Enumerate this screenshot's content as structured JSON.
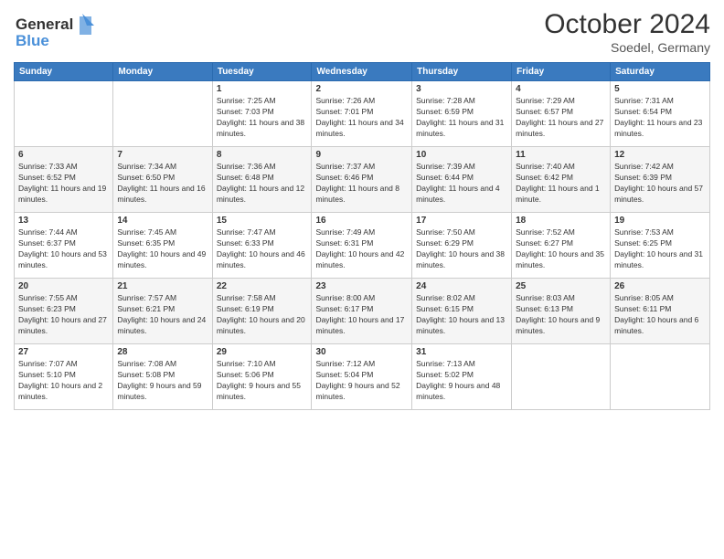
{
  "header": {
    "logo_line1": "General",
    "logo_line2": "Blue",
    "month": "October 2024",
    "location": "Soedel, Germany"
  },
  "days_of_week": [
    "Sunday",
    "Monday",
    "Tuesday",
    "Wednesday",
    "Thursday",
    "Friday",
    "Saturday"
  ],
  "weeks": [
    [
      {
        "day": "",
        "info": ""
      },
      {
        "day": "",
        "info": ""
      },
      {
        "day": "1",
        "info": "Sunrise: 7:25 AM\nSunset: 7:03 PM\nDaylight: 11 hours and 38 minutes."
      },
      {
        "day": "2",
        "info": "Sunrise: 7:26 AM\nSunset: 7:01 PM\nDaylight: 11 hours and 34 minutes."
      },
      {
        "day": "3",
        "info": "Sunrise: 7:28 AM\nSunset: 6:59 PM\nDaylight: 11 hours and 31 minutes."
      },
      {
        "day": "4",
        "info": "Sunrise: 7:29 AM\nSunset: 6:57 PM\nDaylight: 11 hours and 27 minutes."
      },
      {
        "day": "5",
        "info": "Sunrise: 7:31 AM\nSunset: 6:54 PM\nDaylight: 11 hours and 23 minutes."
      }
    ],
    [
      {
        "day": "6",
        "info": "Sunrise: 7:33 AM\nSunset: 6:52 PM\nDaylight: 11 hours and 19 minutes."
      },
      {
        "day": "7",
        "info": "Sunrise: 7:34 AM\nSunset: 6:50 PM\nDaylight: 11 hours and 16 minutes."
      },
      {
        "day": "8",
        "info": "Sunrise: 7:36 AM\nSunset: 6:48 PM\nDaylight: 11 hours and 12 minutes."
      },
      {
        "day": "9",
        "info": "Sunrise: 7:37 AM\nSunset: 6:46 PM\nDaylight: 11 hours and 8 minutes."
      },
      {
        "day": "10",
        "info": "Sunrise: 7:39 AM\nSunset: 6:44 PM\nDaylight: 11 hours and 4 minutes."
      },
      {
        "day": "11",
        "info": "Sunrise: 7:40 AM\nSunset: 6:42 PM\nDaylight: 11 hours and 1 minute."
      },
      {
        "day": "12",
        "info": "Sunrise: 7:42 AM\nSunset: 6:39 PM\nDaylight: 10 hours and 57 minutes."
      }
    ],
    [
      {
        "day": "13",
        "info": "Sunrise: 7:44 AM\nSunset: 6:37 PM\nDaylight: 10 hours and 53 minutes."
      },
      {
        "day": "14",
        "info": "Sunrise: 7:45 AM\nSunset: 6:35 PM\nDaylight: 10 hours and 49 minutes."
      },
      {
        "day": "15",
        "info": "Sunrise: 7:47 AM\nSunset: 6:33 PM\nDaylight: 10 hours and 46 minutes."
      },
      {
        "day": "16",
        "info": "Sunrise: 7:49 AM\nSunset: 6:31 PM\nDaylight: 10 hours and 42 minutes."
      },
      {
        "day": "17",
        "info": "Sunrise: 7:50 AM\nSunset: 6:29 PM\nDaylight: 10 hours and 38 minutes."
      },
      {
        "day": "18",
        "info": "Sunrise: 7:52 AM\nSunset: 6:27 PM\nDaylight: 10 hours and 35 minutes."
      },
      {
        "day": "19",
        "info": "Sunrise: 7:53 AM\nSunset: 6:25 PM\nDaylight: 10 hours and 31 minutes."
      }
    ],
    [
      {
        "day": "20",
        "info": "Sunrise: 7:55 AM\nSunset: 6:23 PM\nDaylight: 10 hours and 27 minutes."
      },
      {
        "day": "21",
        "info": "Sunrise: 7:57 AM\nSunset: 6:21 PM\nDaylight: 10 hours and 24 minutes."
      },
      {
        "day": "22",
        "info": "Sunrise: 7:58 AM\nSunset: 6:19 PM\nDaylight: 10 hours and 20 minutes."
      },
      {
        "day": "23",
        "info": "Sunrise: 8:00 AM\nSunset: 6:17 PM\nDaylight: 10 hours and 17 minutes."
      },
      {
        "day": "24",
        "info": "Sunrise: 8:02 AM\nSunset: 6:15 PM\nDaylight: 10 hours and 13 minutes."
      },
      {
        "day": "25",
        "info": "Sunrise: 8:03 AM\nSunset: 6:13 PM\nDaylight: 10 hours and 9 minutes."
      },
      {
        "day": "26",
        "info": "Sunrise: 8:05 AM\nSunset: 6:11 PM\nDaylight: 10 hours and 6 minutes."
      }
    ],
    [
      {
        "day": "27",
        "info": "Sunrise: 7:07 AM\nSunset: 5:10 PM\nDaylight: 10 hours and 2 minutes."
      },
      {
        "day": "28",
        "info": "Sunrise: 7:08 AM\nSunset: 5:08 PM\nDaylight: 9 hours and 59 minutes."
      },
      {
        "day": "29",
        "info": "Sunrise: 7:10 AM\nSunset: 5:06 PM\nDaylight: 9 hours and 55 minutes."
      },
      {
        "day": "30",
        "info": "Sunrise: 7:12 AM\nSunset: 5:04 PM\nDaylight: 9 hours and 52 minutes."
      },
      {
        "day": "31",
        "info": "Sunrise: 7:13 AM\nSunset: 5:02 PM\nDaylight: 9 hours and 48 minutes."
      },
      {
        "day": "",
        "info": ""
      },
      {
        "day": "",
        "info": ""
      }
    ]
  ]
}
